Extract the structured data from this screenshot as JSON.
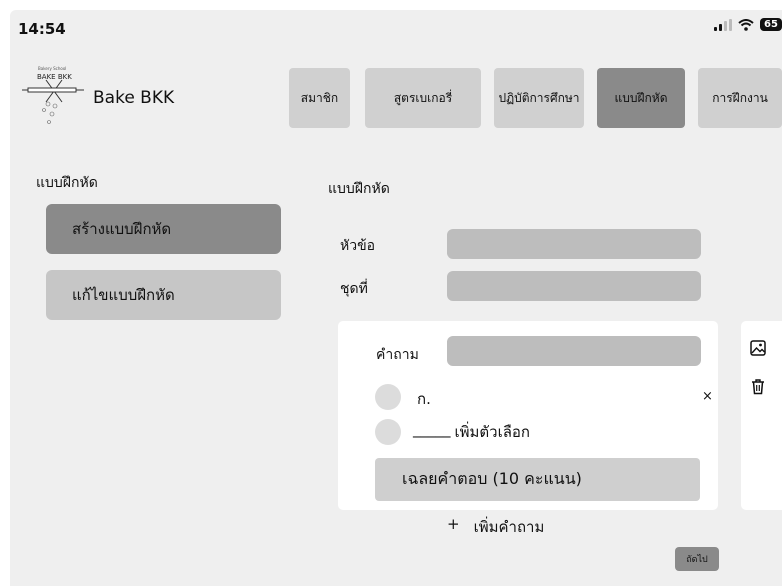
{
  "status": {
    "time": "14:54",
    "battery": "65"
  },
  "brand": {
    "name": "Bake BKK",
    "logo_text": "BAKE BKK"
  },
  "nav": {
    "tabs": [
      {
        "label": "สมาชิก"
      },
      {
        "label": "สูตรเบเกอรี่"
      },
      {
        "label": "ปฏิบัติการศึกษา"
      },
      {
        "label": "แบบฝึกหัด"
      },
      {
        "label": "การฝึกงาน"
      }
    ]
  },
  "sidebar": {
    "title": "แบบฝึกหัด",
    "items": [
      {
        "label": "สร้างแบบฝึกหัด"
      },
      {
        "label": "แก้ไขแบบฝึกหัด"
      }
    ]
  },
  "form": {
    "title": "แบบฝึกหัด",
    "topic_label": "หัวข้อ",
    "set_label": "ชุดที่",
    "question_label": "คำถาม",
    "option_1": "ก.",
    "add_option_blank": "_____",
    "add_option": "เพิ่มตัวเลือก",
    "remove_option": "×",
    "answer_button": "เฉลยคำตอบ (10 คะแนน)",
    "add_question_plus": "+",
    "add_question": "เพิ่มคำถาม",
    "next": "ถัดไป"
  },
  "icons": {
    "image": "image-icon",
    "trash": "trash-icon"
  }
}
